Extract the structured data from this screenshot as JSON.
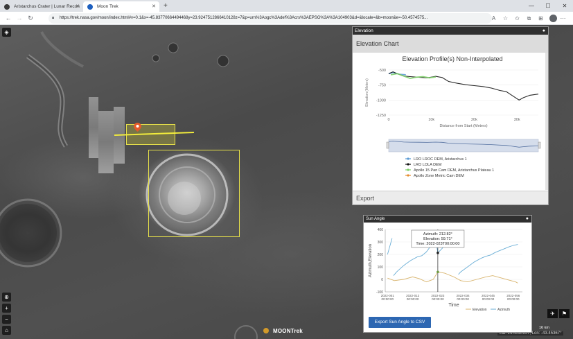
{
  "browser": {
    "tabs": [
      {
        "label": "Aristarchus Crater | Lunar Recon",
        "active": false
      },
      {
        "label": "Moon Trek",
        "active": true
      }
    ],
    "url": "https://trek.nasa.gov/moon/index.html#v=0.1&x=-45.83770664494468y=23.9247512866410128z=7&p=urn%3Aogc%3Adef%3Acrs%3AEPSG%3A%3A104903&d=&locale=&b=moon&e=-50.4574575..."
  },
  "map": {
    "brand": "MOONTrek",
    "scale_label": "16 km",
    "coordinate_readout": "Lat: 24.4090957,  Lon: -43.45367°"
  },
  "elevation_panel": {
    "window_title": "Elevation",
    "header": "Elevation Chart",
    "export_label": "Export",
    "chart_data": {
      "type": "line",
      "title": "Elevation Profile(s) Non-Interpolated",
      "xlabel": "Distance from Start (Meters)",
      "ylabel": "Elevation (Meters)",
      "xlim": [
        0,
        35000
      ],
      "ylim": [
        -1250,
        -500
      ],
      "y_ticks": [
        -500,
        -750,
        -1000,
        -1250
      ],
      "x_tick_labels": [
        "0",
        "10k",
        "20k",
        "30k"
      ],
      "x_ticks": [
        0,
        10000,
        20000,
        30000
      ],
      "series": [
        {
          "name": "LRO LROC DEM, Aristarchus 1",
          "color": "#5b9bd5",
          "x": [
            0,
            1000,
            2500,
            4000
          ],
          "y": [
            -560,
            -540,
            -570,
            -580
          ]
        },
        {
          "name": "LRO LOLA DEM",
          "color": "#111111",
          "x": [
            0,
            1000,
            2000,
            3500,
            5000,
            7000,
            9000,
            11000,
            12500,
            14000,
            16000,
            18000,
            20000,
            22000,
            24000,
            26000,
            27500,
            29000,
            30500,
            31500,
            33000,
            35000
          ],
          "y": [
            -560,
            -530,
            -560,
            -600,
            -610,
            -620,
            -630,
            -605,
            -625,
            -690,
            -720,
            -745,
            -760,
            -775,
            -800,
            -840,
            -860,
            -930,
            -1000,
            -960,
            -920,
            -900
          ]
        },
        {
          "name": "Apollo 15 Pan Cam DEM, Aristarchus Plateau 1",
          "color": "#7fd06b",
          "x": [
            500,
            2000,
            3500,
            5000,
            6500,
            8000,
            9500,
            11000
          ],
          "y": [
            -580,
            -560,
            -600,
            -640,
            -620,
            -610,
            -630,
            -615
          ]
        },
        {
          "name": "Apollo Zone Metric Cam DEM",
          "color": "#e58c2e",
          "x": [],
          "y": []
        }
      ]
    }
  },
  "sun_panel": {
    "window_title": "Sun Angle",
    "export_button": "Export Sun Angle to CSV",
    "tooltip": {
      "azimuth": "Azimuth: 212.82°",
      "elevation": "Elevation: 59.71°",
      "time": "Time: 2022-023T00:00:00"
    },
    "chart_data": {
      "type": "line",
      "xlabel": "Time",
      "ylabel": "Azimuth,Elevation",
      "ylim": [
        -100,
        400
      ],
      "y_ticks": [
        -100,
        0,
        100,
        200,
        300,
        400
      ],
      "x_tick_labels": [
        [
          "2022-001",
          "00:00:00"
        ],
        [
          "2022-012",
          "00:00:00"
        ],
        [
          "2022-023",
          "00:00:00"
        ],
        [
          "2022-034",
          "00:00:00"
        ],
        [
          "2022-045",
          "00:00:00"
        ],
        [
          "2022-056",
          "00:00:00"
        ]
      ],
      "x_ticks": [
        1,
        12,
        23,
        34,
        45,
        56
      ],
      "xlim": [
        0,
        60
      ],
      "cursor_day": 23,
      "series": [
        {
          "name": "Azimuth",
          "color": "#6aaed6",
          "x": [
            1,
            3,
            3.6,
            5,
            8,
            11,
            14,
            16,
            18,
            20,
            22,
            23,
            25,
            27,
            30,
            31.6,
            32,
            33,
            36,
            39,
            42,
            44,
            46,
            48,
            50,
            52,
            54,
            56,
            58
          ],
          "y": [
            200,
            330,
            30,
            60,
            110,
            150,
            180,
            190,
            220,
            270,
            330,
            212,
            250,
            300,
            330,
            360,
            40,
            60,
            100,
            140,
            170,
            185,
            195,
            215,
            230,
            245,
            260,
            272,
            280
          ]
        },
        {
          "name": "Elevation",
          "color": "#d8b36b",
          "x": [
            1,
            4,
            8,
            12,
            15,
            18,
            21,
            23,
            26,
            30,
            33,
            36,
            40,
            44,
            47,
            51,
            54,
            57,
            58
          ],
          "y": [
            10,
            -10,
            0,
            20,
            5,
            -20,
            0,
            59.71,
            50,
            20,
            -10,
            -20,
            0,
            20,
            30,
            10,
            -5,
            -20,
            -30
          ]
        }
      ]
    }
  }
}
